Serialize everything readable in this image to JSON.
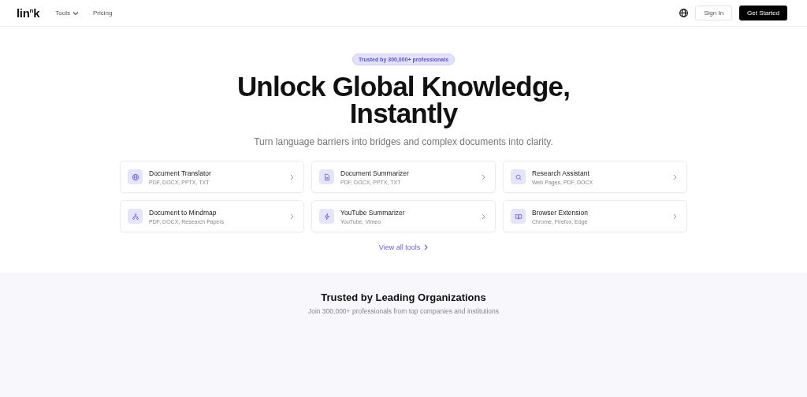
{
  "header": {
    "logo": "lin$^{n}$k",
    "nav": [
      {
        "label": "Tools",
        "kind": "dropdown"
      },
      {
        "label": "Pricing",
        "kind": "link"
      }
    ],
    "sign_in": "Sign In",
    "get_started": "Get Started"
  },
  "hero": {
    "badge": "Trusted by 300,000+ professionals",
    "title_lines": [
      "Unlock Global Knowledge,",
      "Instantly"
    ],
    "subtitle": "Turn language barriers into bridges and complex documents into clarity.",
    "tools": [
      {
        "kind": "globe",
        "name": "Document Translator",
        "formats": "PDF, DOCX, PPTX, TXT"
      },
      {
        "kind": "document",
        "name": "Document Summarizer",
        "formats": "PDF, DOCX, PPTX, TXT"
      },
      {
        "kind": "search",
        "name": "Research Assistant",
        "formats": "Web Pages, PDF, DOCX"
      },
      {
        "kind": "mindmap",
        "name": "Document to Mindmap",
        "formats": "PDF, DOCX, Research Papers"
      },
      {
        "kind": "bolt",
        "name": "YouTube Summarizer",
        "formats": "YouTube, Vimeo"
      },
      {
        "kind": "book",
        "name": "Browser Extension",
        "formats": "Chrome, Firefox, Edge"
      }
    ],
    "view_all": "View all tools"
  },
  "trusted": {
    "title": "Trusted by Leading Organizations",
    "subtitle": "Join 300,000+ professionals from top companies and institutions"
  }
}
